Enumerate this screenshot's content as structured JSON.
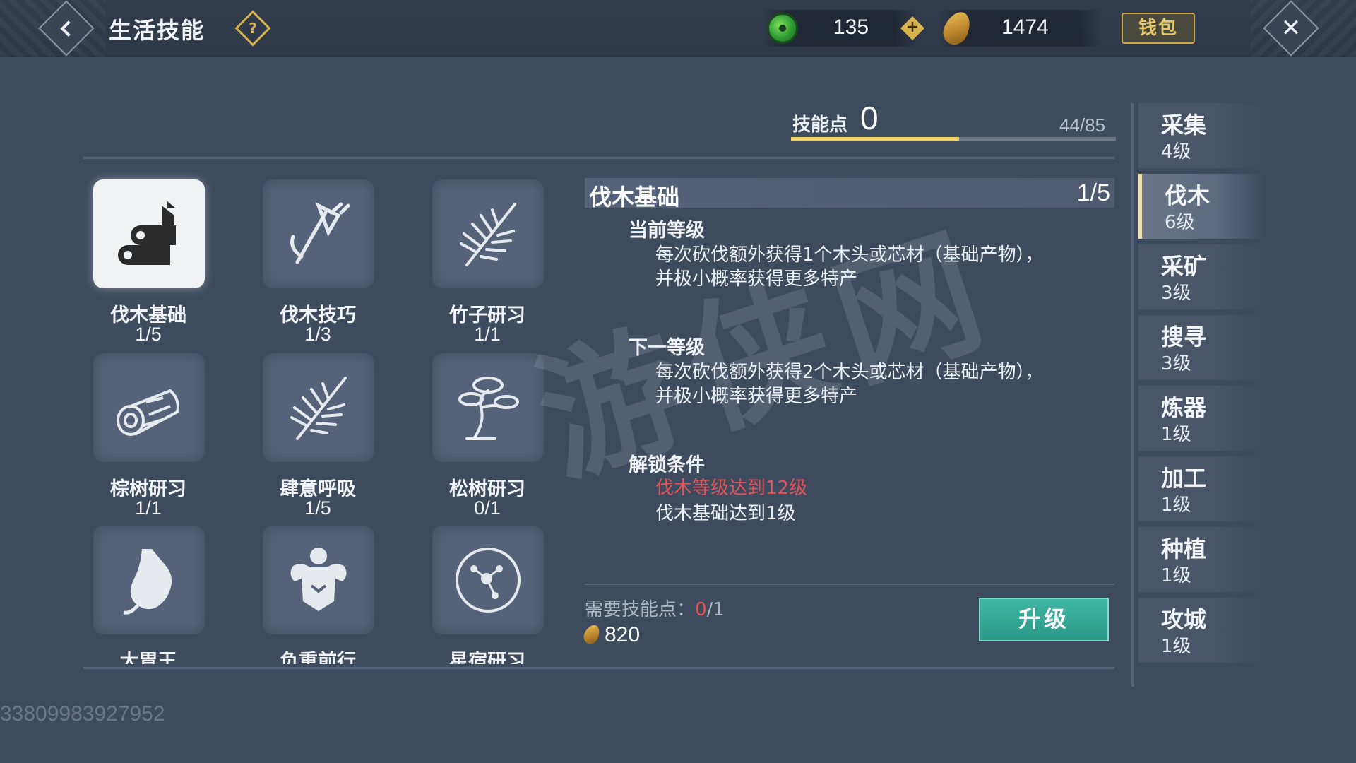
{
  "header": {
    "title": "生活技能",
    "help_icon": "question-icon",
    "currency": [
      {
        "icon": "jade-icon",
        "value": "135",
        "color": "#2f9b34"
      },
      {
        "icon": "leaf-coin-icon",
        "value": "1474",
        "color": "#d6a03a"
      }
    ],
    "wallet_label": "钱包"
  },
  "skill_points": {
    "label": "技能点",
    "value": "0",
    "progress_text": "44/85",
    "progress_fraction": 0.5176
  },
  "skills": [
    {
      "name": "伐木基础",
      "level": "1/5",
      "icon": "logs-icon",
      "selected": true
    },
    {
      "name": "伐木技巧",
      "level": "1/3",
      "icon": "axe-icon"
    },
    {
      "name": "竹子研习",
      "level": "1/1",
      "icon": "bamboo-icon"
    },
    {
      "name": "棕树研习",
      "level": "1/1",
      "icon": "log-icon"
    },
    {
      "name": "肆意呼吸",
      "level": "1/5",
      "icon": "leaf-branch-icon"
    },
    {
      "name": "松树研习",
      "level": "0/1",
      "icon": "pine-tree-icon"
    },
    {
      "name": "大胃王",
      "icon": "stomach-icon"
    },
    {
      "name": "负重前行",
      "icon": "muscle-icon"
    },
    {
      "name": "星宿研习",
      "icon": "constellation-icon"
    }
  ],
  "detail": {
    "title": "伐木基础",
    "level": "1/5",
    "current_heading": "当前等级",
    "current_text": "每次砍伐额外获得1个木头或芯材（基础产物），并极小概率获得更多特产",
    "next_heading": "下一等级",
    "next_text": "每次砍伐额外获得2个木头或芯材（基础产物），并极小概率获得更多特产",
    "unlock_heading": "解锁条件",
    "unlock_conditions": [
      {
        "text": "伐木等级达到12级",
        "met": false
      },
      {
        "text": "伐木基础达到1级",
        "met": true
      }
    ],
    "need_label": "需要技能点：",
    "need_current": "0",
    "need_total": "/1",
    "cost": "820",
    "upgrade_label": "升级"
  },
  "categories": [
    {
      "name": "采集",
      "level": "4级"
    },
    {
      "name": "伐木",
      "level": "6级",
      "active": true
    },
    {
      "name": "采矿",
      "level": "3级"
    },
    {
      "name": "搜寻",
      "level": "3级"
    },
    {
      "name": "炼器",
      "level": "1级"
    },
    {
      "name": "加工",
      "level": "1级"
    },
    {
      "name": "种植",
      "level": "1级"
    },
    {
      "name": "攻城",
      "level": "1级"
    }
  ],
  "watermark": "游侠网",
  "user_id": "33809983927952"
}
